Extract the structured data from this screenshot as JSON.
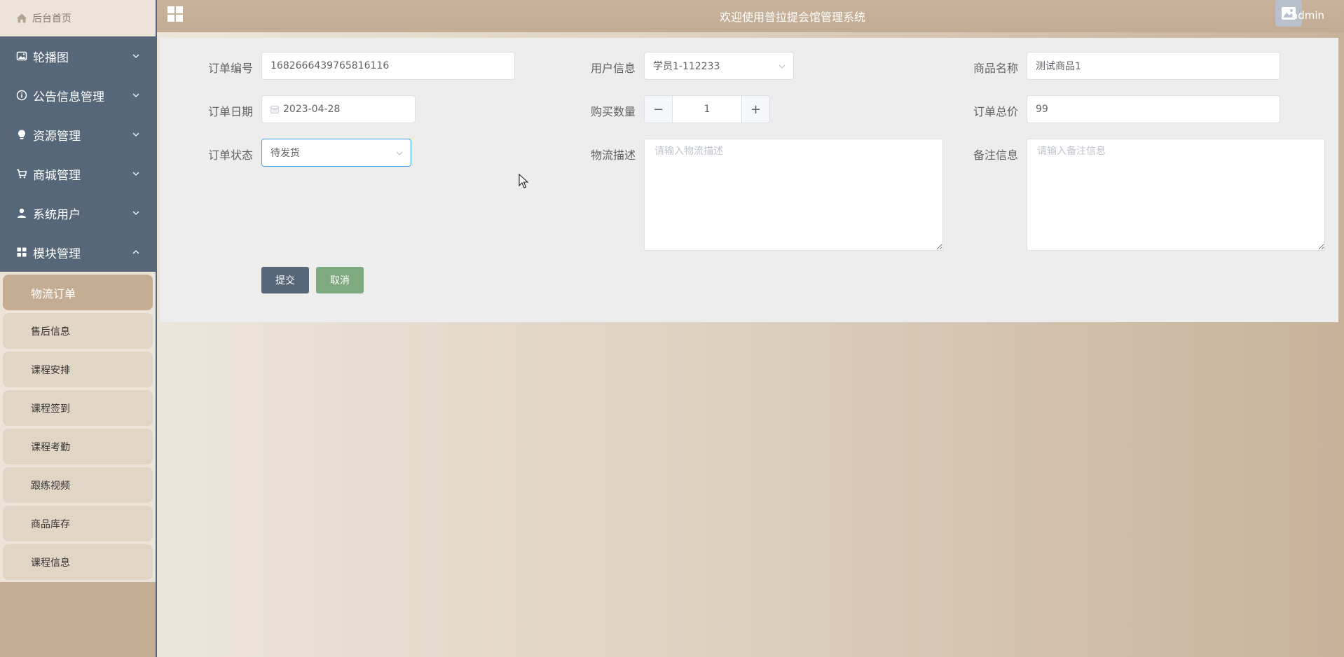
{
  "sidebar": {
    "home_label": "后台首页",
    "menu": [
      {
        "label": "轮播图",
        "icon": "image-icon"
      },
      {
        "label": "公告信息管理",
        "icon": "info-circle-icon"
      },
      {
        "label": "资源管理",
        "icon": "bulb-icon"
      },
      {
        "label": "商城管理",
        "icon": "cart-icon"
      },
      {
        "label": "系统用户",
        "icon": "user-icon"
      },
      {
        "label": "模块管理",
        "icon": "grid-icon"
      }
    ],
    "submenu": [
      {
        "label": "物流订单",
        "active": true
      },
      {
        "label": "售后信息"
      },
      {
        "label": "课程安排"
      },
      {
        "label": "课程签到"
      },
      {
        "label": "课程考勤"
      },
      {
        "label": "跟练视频"
      },
      {
        "label": "商品库存"
      },
      {
        "label": "课程信息"
      }
    ]
  },
  "header": {
    "title": "欢迎使用普拉提会馆管理系统",
    "username": "admin"
  },
  "form": {
    "order_no": {
      "label": "订单编号",
      "value": "1682666439765816116"
    },
    "user_info": {
      "label": "用户信息",
      "value": "学员1-112233"
    },
    "product_name": {
      "label": "商品名称",
      "value": "测试商品1"
    },
    "order_date": {
      "label": "订单日期",
      "value": "2023-04-28"
    },
    "quantity": {
      "label": "购买数量",
      "value": "1",
      "minus": "−",
      "plus": "+"
    },
    "total_price": {
      "label": "订单总价",
      "value": "99"
    },
    "order_status": {
      "label": "订单状态",
      "value": "待发货"
    },
    "logistics_desc": {
      "label": "物流描述",
      "placeholder": "请输入物流描述"
    },
    "remarks": {
      "label": "备注信息",
      "placeholder": "请输入备注信息"
    },
    "submit_label": "提交",
    "cancel_label": "取消"
  },
  "colors": {
    "sidebar_dark": "#56677a",
    "accent": "#c5ad94",
    "submit": "#56677a",
    "cancel": "#7faa7f",
    "select_focus": "#409eff"
  }
}
